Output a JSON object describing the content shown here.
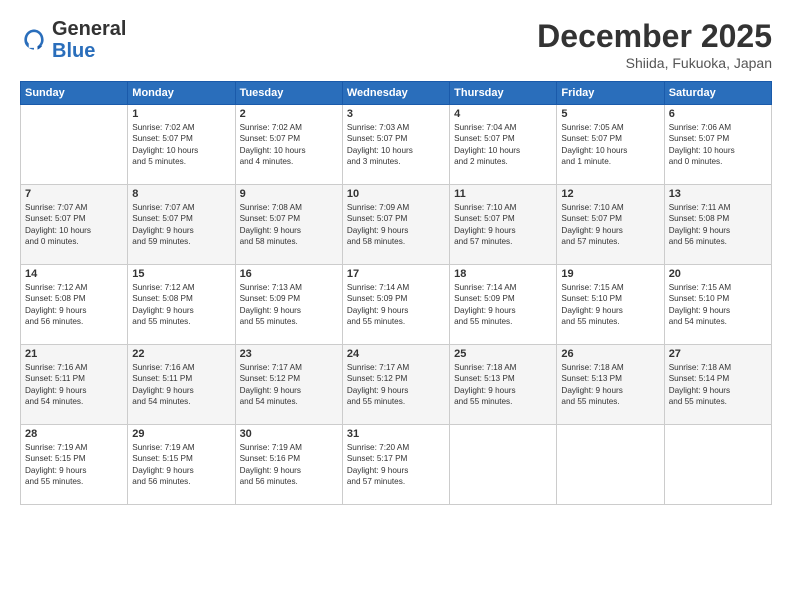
{
  "logo": {
    "line1": "General",
    "line2": "Blue"
  },
  "header": {
    "month": "December 2025",
    "location": "Shiida, Fukuoka, Japan"
  },
  "weekdays": [
    "Sunday",
    "Monday",
    "Tuesday",
    "Wednesday",
    "Thursday",
    "Friday",
    "Saturday"
  ],
  "weeks": [
    [
      {
        "day": "",
        "text": ""
      },
      {
        "day": "1",
        "text": "Sunrise: 7:02 AM\nSunset: 5:07 PM\nDaylight: 10 hours\nand 5 minutes."
      },
      {
        "day": "2",
        "text": "Sunrise: 7:02 AM\nSunset: 5:07 PM\nDaylight: 10 hours\nand 4 minutes."
      },
      {
        "day": "3",
        "text": "Sunrise: 7:03 AM\nSunset: 5:07 PM\nDaylight: 10 hours\nand 3 minutes."
      },
      {
        "day": "4",
        "text": "Sunrise: 7:04 AM\nSunset: 5:07 PM\nDaylight: 10 hours\nand 2 minutes."
      },
      {
        "day": "5",
        "text": "Sunrise: 7:05 AM\nSunset: 5:07 PM\nDaylight: 10 hours\nand 1 minute."
      },
      {
        "day": "6",
        "text": "Sunrise: 7:06 AM\nSunset: 5:07 PM\nDaylight: 10 hours\nand 0 minutes."
      }
    ],
    [
      {
        "day": "7",
        "text": "Sunrise: 7:07 AM\nSunset: 5:07 PM\nDaylight: 10 hours\nand 0 minutes."
      },
      {
        "day": "8",
        "text": "Sunrise: 7:07 AM\nSunset: 5:07 PM\nDaylight: 9 hours\nand 59 minutes."
      },
      {
        "day": "9",
        "text": "Sunrise: 7:08 AM\nSunset: 5:07 PM\nDaylight: 9 hours\nand 58 minutes."
      },
      {
        "day": "10",
        "text": "Sunrise: 7:09 AM\nSunset: 5:07 PM\nDaylight: 9 hours\nand 58 minutes."
      },
      {
        "day": "11",
        "text": "Sunrise: 7:10 AM\nSunset: 5:07 PM\nDaylight: 9 hours\nand 57 minutes."
      },
      {
        "day": "12",
        "text": "Sunrise: 7:10 AM\nSunset: 5:07 PM\nDaylight: 9 hours\nand 57 minutes."
      },
      {
        "day": "13",
        "text": "Sunrise: 7:11 AM\nSunset: 5:08 PM\nDaylight: 9 hours\nand 56 minutes."
      }
    ],
    [
      {
        "day": "14",
        "text": "Sunrise: 7:12 AM\nSunset: 5:08 PM\nDaylight: 9 hours\nand 56 minutes."
      },
      {
        "day": "15",
        "text": "Sunrise: 7:12 AM\nSunset: 5:08 PM\nDaylight: 9 hours\nand 55 minutes."
      },
      {
        "day": "16",
        "text": "Sunrise: 7:13 AM\nSunset: 5:09 PM\nDaylight: 9 hours\nand 55 minutes."
      },
      {
        "day": "17",
        "text": "Sunrise: 7:14 AM\nSunset: 5:09 PM\nDaylight: 9 hours\nand 55 minutes."
      },
      {
        "day": "18",
        "text": "Sunrise: 7:14 AM\nSunset: 5:09 PM\nDaylight: 9 hours\nand 55 minutes."
      },
      {
        "day": "19",
        "text": "Sunrise: 7:15 AM\nSunset: 5:10 PM\nDaylight: 9 hours\nand 55 minutes."
      },
      {
        "day": "20",
        "text": "Sunrise: 7:15 AM\nSunset: 5:10 PM\nDaylight: 9 hours\nand 54 minutes."
      }
    ],
    [
      {
        "day": "21",
        "text": "Sunrise: 7:16 AM\nSunset: 5:11 PM\nDaylight: 9 hours\nand 54 minutes."
      },
      {
        "day": "22",
        "text": "Sunrise: 7:16 AM\nSunset: 5:11 PM\nDaylight: 9 hours\nand 54 minutes."
      },
      {
        "day": "23",
        "text": "Sunrise: 7:17 AM\nSunset: 5:12 PM\nDaylight: 9 hours\nand 54 minutes."
      },
      {
        "day": "24",
        "text": "Sunrise: 7:17 AM\nSunset: 5:12 PM\nDaylight: 9 hours\nand 55 minutes."
      },
      {
        "day": "25",
        "text": "Sunrise: 7:18 AM\nSunset: 5:13 PM\nDaylight: 9 hours\nand 55 minutes."
      },
      {
        "day": "26",
        "text": "Sunrise: 7:18 AM\nSunset: 5:13 PM\nDaylight: 9 hours\nand 55 minutes."
      },
      {
        "day": "27",
        "text": "Sunrise: 7:18 AM\nSunset: 5:14 PM\nDaylight: 9 hours\nand 55 minutes."
      }
    ],
    [
      {
        "day": "28",
        "text": "Sunrise: 7:19 AM\nSunset: 5:15 PM\nDaylight: 9 hours\nand 55 minutes."
      },
      {
        "day": "29",
        "text": "Sunrise: 7:19 AM\nSunset: 5:15 PM\nDaylight: 9 hours\nand 56 minutes."
      },
      {
        "day": "30",
        "text": "Sunrise: 7:19 AM\nSunset: 5:16 PM\nDaylight: 9 hours\nand 56 minutes."
      },
      {
        "day": "31",
        "text": "Sunrise: 7:20 AM\nSunset: 5:17 PM\nDaylight: 9 hours\nand 57 minutes."
      },
      {
        "day": "",
        "text": ""
      },
      {
        "day": "",
        "text": ""
      },
      {
        "day": "",
        "text": ""
      }
    ]
  ]
}
